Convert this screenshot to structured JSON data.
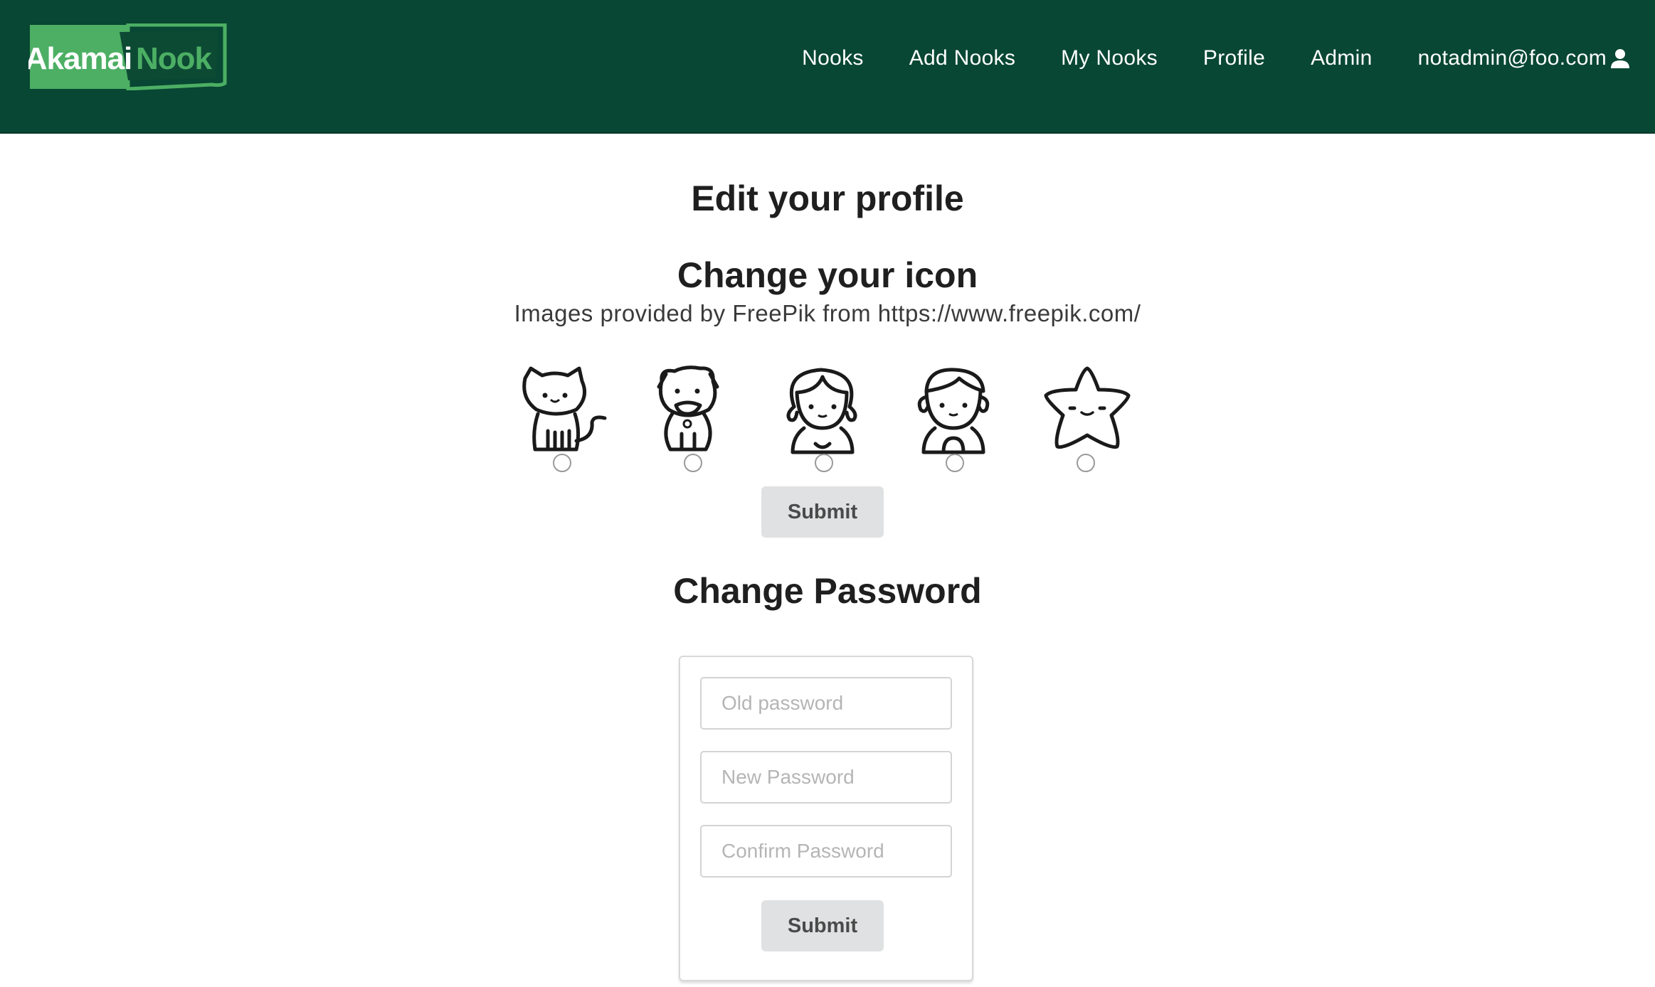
{
  "brand": {
    "logo_left": "Akamai",
    "logo_right": "Nook",
    "colors": {
      "navbar": "#084733",
      "logo_green": "#4caf64"
    }
  },
  "nav": {
    "items": [
      {
        "label": "Nooks"
      },
      {
        "label": "Add Nooks"
      },
      {
        "label": "My Nooks"
      },
      {
        "label": "Profile"
      },
      {
        "label": "Admin"
      }
    ],
    "user": {
      "email": "notadmin@foo.com",
      "icon": "user-icon"
    }
  },
  "page": {
    "title": "Edit your profile"
  },
  "icon_section": {
    "heading": "Change your icon",
    "credit": "Images provided by FreePik from https://www.freepik.com/",
    "choices": [
      {
        "name": "cat-icon"
      },
      {
        "name": "dog-icon"
      },
      {
        "name": "girl-icon"
      },
      {
        "name": "boy-icon"
      },
      {
        "name": "star-icon"
      }
    ],
    "submit_label": "Submit"
  },
  "password_section": {
    "heading": "Change Password",
    "old_placeholder": "Old password",
    "new_placeholder": "New Password",
    "confirm_placeholder": "Confirm Password",
    "submit_label": "Submit"
  }
}
